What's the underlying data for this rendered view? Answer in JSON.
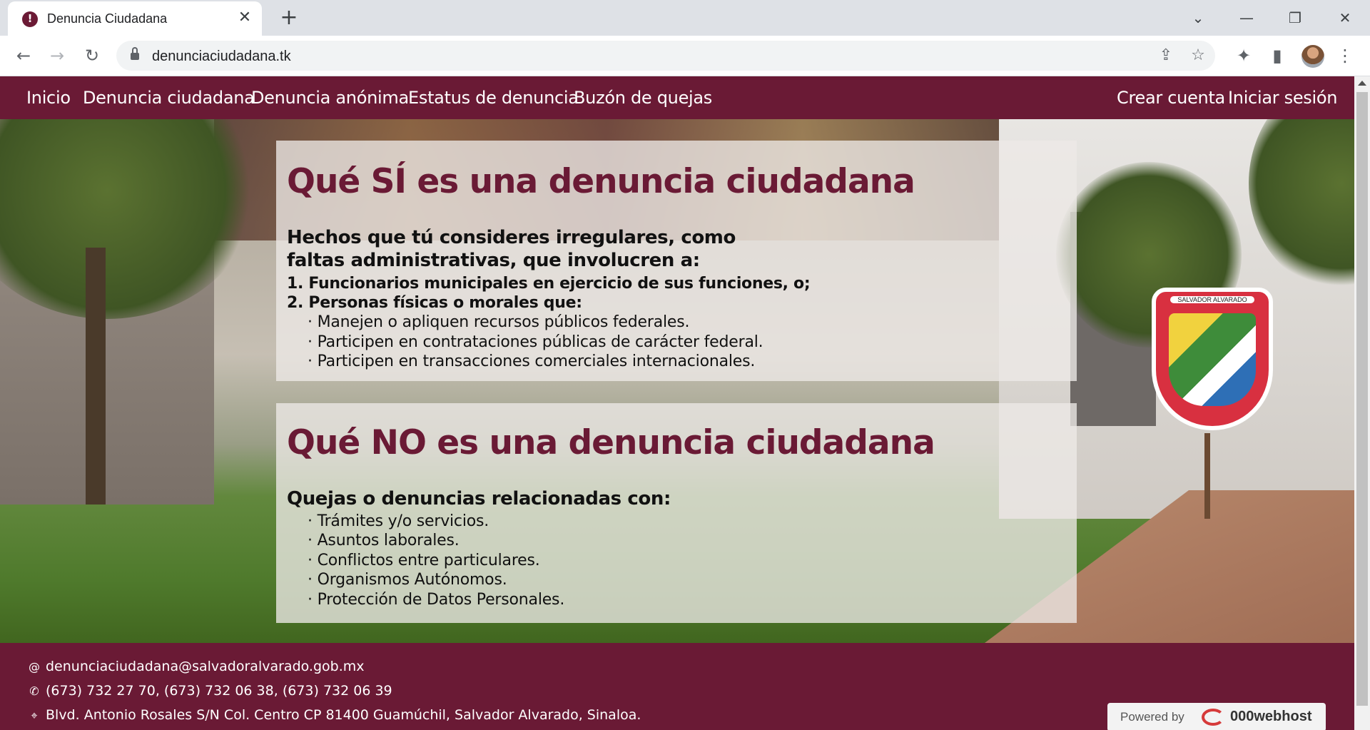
{
  "browser": {
    "tab_title": "Denuncia Ciudadana",
    "tab_close_glyph": "✕",
    "new_tab_glyph": "+",
    "url": "denunciaciudadana.tk",
    "nav_back_glyph": "←",
    "nav_forward_glyph": "→",
    "reload_glyph": "↻",
    "tab_search_glyph": "⌄",
    "minimize_glyph": "—",
    "restore_glyph": "❐",
    "close_glyph": "✕",
    "share_glyph": "⇪",
    "star_glyph": "☆",
    "extensions_glyph": "✦",
    "sidepanel_glyph": "▮",
    "menu_glyph": "⋮",
    "icons": [
      "favicon",
      "lock-icon",
      "share-icon",
      "star-icon",
      "extensions-icon",
      "side-panel-icon",
      "profile-avatar",
      "kebab-menu-icon"
    ]
  },
  "nav": {
    "left": [
      "Inicio",
      "Denuncia ciudadana",
      "Denuncia anónima",
      "Estatus de denuncia",
      "Buzón de quejas"
    ],
    "right": [
      "Crear cuenta",
      "Iniciar sesión"
    ]
  },
  "crest_text": "SALVADOR ALVARADO",
  "section_yes": {
    "title": "Qué SÍ es una denuncia ciudadana",
    "lead": "Hechos que tú consideres irregulares, como faltas administrativas, que involucren a:",
    "items": [
      "1. Funcionarios municipales en ejercicio de sus funciones, o;",
      "2. Personas físicas o morales que:"
    ],
    "bullets": [
      "· Manejen o apliquen recursos públicos federales.",
      "· Participen en contrataciones públicas de carácter federal.",
      "· Participen en transacciones comerciales internacionales."
    ]
  },
  "section_no": {
    "title": "Qué NO es una denuncia ciudadana",
    "lead": "Quejas o denuncias relacionadas con:",
    "bullets": [
      "· Trámites y/o servicios.",
      "· Asuntos laborales.",
      "· Conflictos entre particulares.",
      "· Organismos Autónomos.",
      "· Protección de Datos Personales."
    ]
  },
  "footer": {
    "email_glyph": "@",
    "phone_glyph": "✆",
    "location_glyph": "⌖",
    "email": "denunciaciudadana@salvadoralvarado.gob.mx",
    "phones": "(673) 732 27 70, (673) 732 06 38, (673) 732 06 39",
    "address": "Blvd. Antonio Rosales S/N Col. Centro CP 81400 Guamúchil, Salvador Alvarado, Sinaloa.",
    "powered_by": "Powered by",
    "host": "000webhost"
  },
  "colors": {
    "brand": "#6a1a35",
    "card_bg": "rgba(237,233,231,0.78)"
  }
}
